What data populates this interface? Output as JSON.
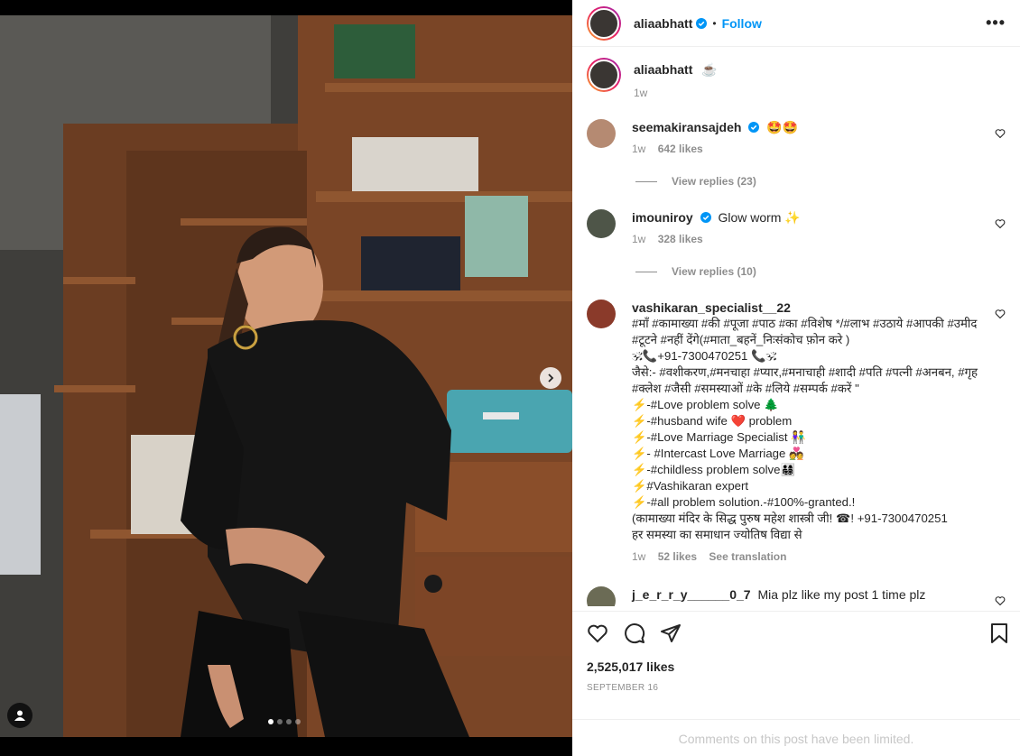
{
  "post": {
    "username": "aliaabhatt",
    "follow_label": "Follow",
    "bullet": "•",
    "more": "•••"
  },
  "caption": {
    "username": "aliaabhatt",
    "text": "☕",
    "time": "1w"
  },
  "comments": [
    {
      "username": "seemakiransajdeh",
      "verified": true,
      "text": "🤩🤩",
      "time": "1w",
      "likes": "642 likes",
      "replies": "View replies (23)"
    },
    {
      "username": "imouniroy",
      "verified": true,
      "text": "Glow worm ✨",
      "time": "1w",
      "likes": "328 likes",
      "replies": "View replies (10)"
    },
    {
      "username": "vashikaran_specialist__22",
      "verified": false,
      "text": "#माँ #कामाख्या #की #पूजा #पाठ #का #विशेष */#लाभ #उठाये #आपकी #उमीद #टूटने #नहीं देंगे(#माता_बहनें_निःसंकोच फ़ोन करे )\n🕉📞+91-7300470251 📞🕉\nजैसे:- #वशीकरण,#मनचाहा #प्यार,#मनाचाही #शादी #पति #पत्नी #अनबन, #गृह #क्लेश #जैसी #समस्याओं #के #लिये #सम्पर्क #करें \"\n⚡-#Love problem solve 🌲\n⚡-#husband wife ❤️ problem\n⚡-#Love Marriage Specialist 👫\n⚡- #Intercast Love Marriage 💑\n⚡-#childless problem solve👨‍👩‍👧‍👦\n⚡#Vashikaran expert\n⚡-#all problem solution.-#100%-granted.!\n(कामाख्या मंदिर के सिद्ध पुरुष महेश शास्त्री जी! ☎! +91-7300470251\nहर समस्या का समाधान ज्योतिष विद्या से",
      "time": "1w",
      "likes": "52 likes",
      "translate": "See translation"
    },
    {
      "username": "j_e_r_r_y______0_7",
      "verified": false,
      "text": "Mia plz like my post 1 time plz"
    }
  ],
  "likes_count": "2,525,017 likes",
  "date": "SEPTEMBER 16",
  "limited": "Comments on this post have been limited.",
  "icons": {
    "like": "heart-icon",
    "comment": "comment-icon",
    "share": "share-icon",
    "save": "bookmark-icon",
    "verified": "verified-badge-icon",
    "next": "chevron-right-icon",
    "user_tag": "user-tag-icon"
  },
  "colors": {
    "accent": "#0095f6",
    "verified": "#0095f6",
    "secondary_text": "#8e8e8e"
  },
  "carousel": {
    "total": 4,
    "active": 1
  }
}
